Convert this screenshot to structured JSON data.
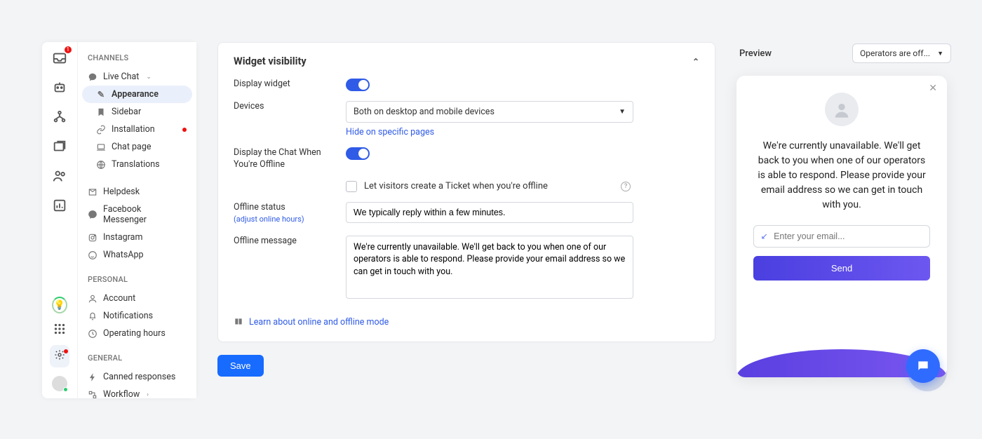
{
  "iconbar": {
    "inbox_badge": "1"
  },
  "sidebar": {
    "channels_label": "CHANNELS",
    "livechat": "Live Chat",
    "appearance": "Appearance",
    "sidebar_item": "Sidebar",
    "installation": "Installation",
    "chatpage": "Chat page",
    "translations": "Translations",
    "helpdesk": "Helpdesk",
    "facebook": "Facebook Messenger",
    "instagram": "Instagram",
    "whatsapp": "WhatsApp",
    "personal_label": "PERSONAL",
    "account": "Account",
    "notifications": "Notifications",
    "operating_hours": "Operating hours",
    "general_label": "GENERAL",
    "canned": "Canned responses",
    "workflow": "Workflow"
  },
  "card": {
    "title": "Widget visibility",
    "display_widget": "Display widget",
    "devices": "Devices",
    "devices_value": "Both on desktop and mobile devices",
    "hide_pages": "Hide on specific pages",
    "display_offline": "Display the Chat When You're Offline",
    "let_ticket": "Let visitors create a Ticket when you're offline",
    "offline_status": "Offline status",
    "adjust_hours": "(adjust online hours)",
    "offline_status_value": "We typically reply within a few minutes.",
    "offline_message": "Offline message",
    "offline_message_value": "We're currently unavailable. We'll get back to you when one of our operators is able to respond. Please provide your email address so we can get in touch with you.",
    "learn": "Learn about online and offline mode",
    "save": "Save"
  },
  "preview": {
    "label": "Preview",
    "dropdown": "Operators are off...",
    "message": "We're currently unavailable. We'll get back to you when one of our operators is able to respond. Please provide your email address so we can get in touch with you.",
    "email_placeholder": "Enter your email...",
    "send": "Send"
  }
}
